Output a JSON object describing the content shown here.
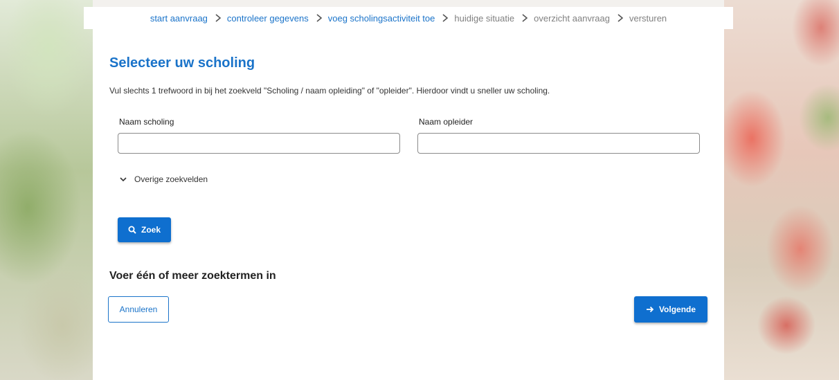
{
  "breadcrumb": {
    "items": [
      {
        "label": "start aanvraag",
        "state": "link"
      },
      {
        "label": "controleer gegevens",
        "state": "link"
      },
      {
        "label": "voeg scholingsactiviteit toe",
        "state": "link"
      },
      {
        "label": "huidige situatie",
        "state": "inactive"
      },
      {
        "label": "overzicht aanvraag",
        "state": "inactive"
      },
      {
        "label": "versturen",
        "state": "inactive"
      }
    ]
  },
  "page": {
    "title": "Selecteer uw scholing",
    "instruction": "Vul slechts 1 trefwoord in bij het zoekveld \"Scholing / naam opleiding\" of \"opleider\". Hierdoor vindt u sneller uw scholing."
  },
  "form": {
    "naam_scholing": {
      "label": "Naam scholing",
      "value": "",
      "placeholder": ""
    },
    "naam_opleider": {
      "label": "Naam opleider",
      "value": "",
      "placeholder": ""
    },
    "more_fields_label": "Overige zoekvelden",
    "search_button": "Zoek"
  },
  "results": {
    "message": "Voer één of meer zoektermen in"
  },
  "actions": {
    "cancel": "Annuleren",
    "next": "Volgende"
  },
  "colors": {
    "accent": "#1a73c9",
    "button": "#0f6fcf",
    "inactive": "#808080"
  },
  "icons": {
    "separator": "chevron-right-icon",
    "toggle": "chevron-down-icon",
    "search": "search-icon",
    "next": "arrow-right-icon"
  }
}
